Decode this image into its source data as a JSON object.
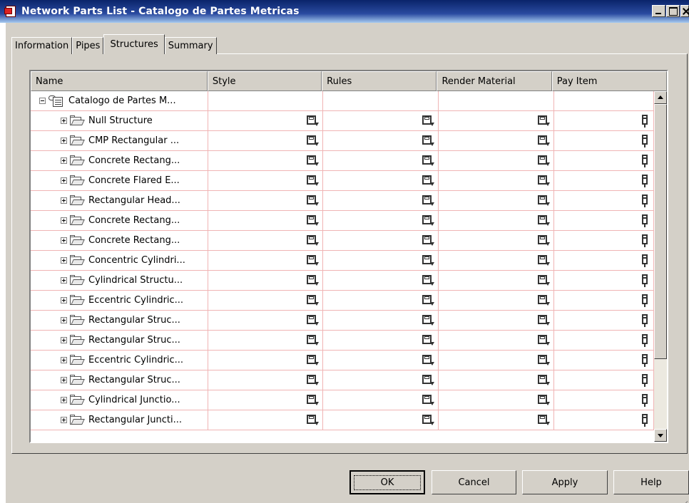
{
  "window": {
    "title": "Network Parts List - Catalogo de Partes Metricas",
    "app_icon": "autocad-icon"
  },
  "tabs": [
    {
      "label": "Information",
      "active": false
    },
    {
      "label": "Pipes",
      "active": false
    },
    {
      "label": "Structures",
      "active": true
    },
    {
      "label": "Summary",
      "active": false
    }
  ],
  "grid": {
    "columns": [
      "Name",
      "Style",
      "Rules",
      "Render Material",
      "Pay Item"
    ],
    "root": {
      "name": "Catalogo de Partes M...",
      "icon": "catalog-icon"
    },
    "rows": [
      "Null Structure",
      "CMP Rectangular ...",
      "Concrete Rectang...",
      "Concrete Flared E...",
      "Rectangular Head...",
      "Concrete Rectang...",
      "Concrete Rectang...",
      "Concentric Cylindri...",
      "Cylindrical Structu...",
      "Eccentric Cylindric...",
      "Rectangular Struc...",
      "Rectangular Struc...",
      "Eccentric Cylindric...",
      "Rectangular Struc...",
      "Cylindrical Junctio...",
      "Rectangular Juncti..."
    ],
    "cell_icons": {
      "style": "save-icon",
      "rules": "save-icon",
      "render_material": "save-icon",
      "pay_item": "pay-item-icon"
    }
  },
  "buttons": {
    "ok": "OK",
    "cancel": "Cancel",
    "apply": "Apply",
    "help": "Help"
  }
}
